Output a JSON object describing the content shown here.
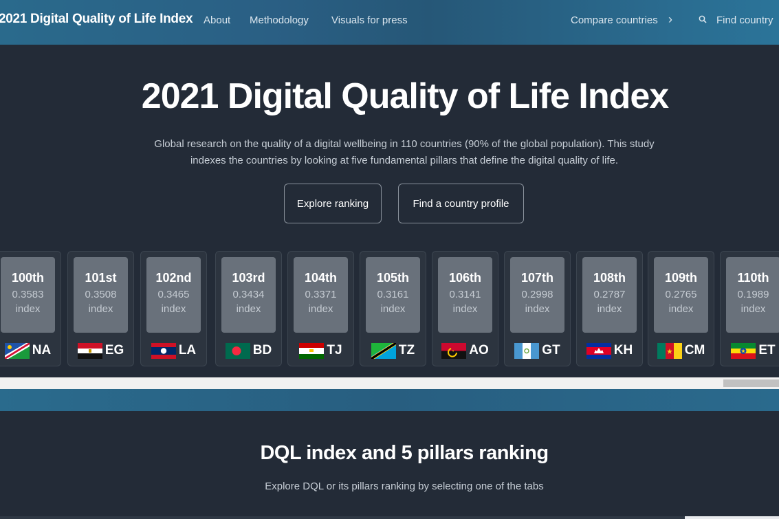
{
  "nav": {
    "brand": "2021 Digital Quality of Life Index",
    "links": [
      "About",
      "Methodology",
      "Visuals for press"
    ],
    "compare": "Compare countries",
    "find": "Find country"
  },
  "hero": {
    "title": "2021 Digital Quality of Life Index",
    "desc_line1": "Global research on the quality of a digital wellbeing in 110 countries (90% of the global population). This study",
    "desc_line2": "indexes the countries by looking at five fundamental pillars that define the digital quality of life.",
    "btn_explore": "Explore ranking",
    "btn_find": "Find a country profile"
  },
  "cards": [
    {
      "rank": "100th",
      "score": "0.3583",
      "label": "index",
      "code": "NA"
    },
    {
      "rank": "101st",
      "score": "0.3508",
      "label": "index",
      "code": "EG"
    },
    {
      "rank": "102nd",
      "score": "0.3465",
      "label": "index",
      "code": "LA"
    },
    {
      "rank": "103rd",
      "score": "0.3434",
      "label": "index",
      "code": "BD"
    },
    {
      "rank": "104th",
      "score": "0.3371",
      "label": "index",
      "code": "TJ"
    },
    {
      "rank": "105th",
      "score": "0.3161",
      "label": "index",
      "code": "TZ"
    },
    {
      "rank": "106th",
      "score": "0.3141",
      "label": "index",
      "code": "AO"
    },
    {
      "rank": "107th",
      "score": "0.2998",
      "label": "index",
      "code": "GT"
    },
    {
      "rank": "108th",
      "score": "0.2787",
      "label": "index",
      "code": "KH"
    },
    {
      "rank": "109th",
      "score": "0.2765",
      "label": "index",
      "code": "CM"
    },
    {
      "rank": "110th",
      "score": "0.1989",
      "label": "index",
      "code": "ET"
    }
  ],
  "section": {
    "title": "DQL index and 5 pillars ranking",
    "subtitle": "Explore DQL or its pillars ranking by selecting one of the tabs"
  }
}
